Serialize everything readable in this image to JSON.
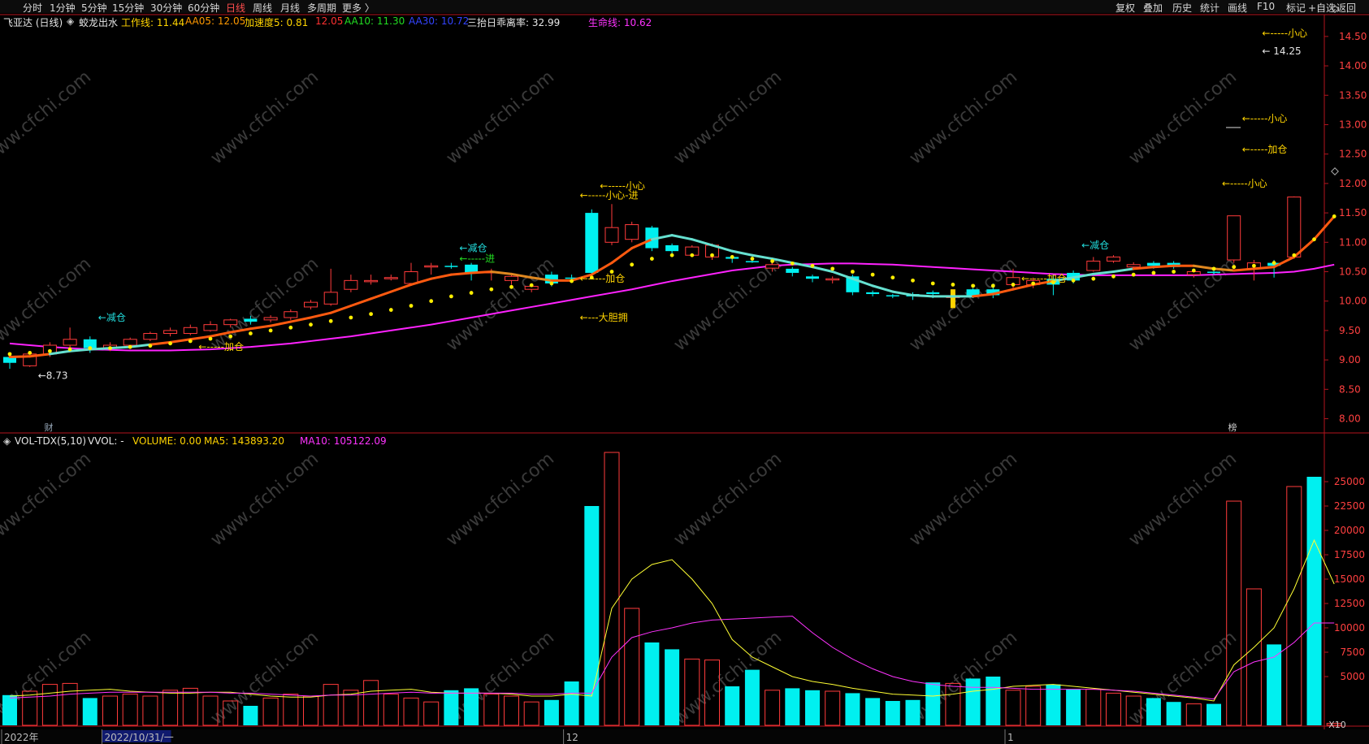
{
  "toolbar": {
    "left": [
      "分时",
      "1分钟",
      "5分钟",
      "15分钟",
      "30分钟",
      "60分钟",
      "日线",
      "周线",
      "月线",
      "多周期",
      "更多 〉"
    ],
    "active": "日线",
    "right": [
      "复权",
      "叠加",
      "历史",
      "统计",
      "画线",
      "F10",
      "标记",
      "+自选",
      "返回"
    ]
  },
  "header": {
    "stock": "飞亚达 (日线)",
    "indicator": "蛟龙出水",
    "items": [
      {
        "label": "工作线: 11.44",
        "color": "#ffd400"
      },
      {
        "label": "AA05: 12.05",
        "color": "#ff9900"
      },
      {
        "label": "加速度5: 0.81",
        "color": "#ffd400"
      },
      {
        "label": "12.05",
        "color": "#ff3030"
      },
      {
        "label": "AA10: 11.30",
        "color": "#22dd22"
      },
      {
        "label": "AA30: 10.72",
        "color": "#3344ff"
      },
      {
        "label": "三抬日乖离率: 32.99",
        "color": "#e6e6e6"
      },
      {
        "label": "生命线: 10.62",
        "color": "#ff33ff"
      }
    ]
  },
  "vol_header": {
    "name": "VOL-TDX(5,10)",
    "vvol": "VVOL: -",
    "volume": "VOLUME: 0.00",
    "ma5": "MA5: 143893.20",
    "ma10": "MA10: 105122.09"
  },
  "marks": {
    "cai": "财",
    "bang": "榜",
    "x10": "X10",
    "rixian": "日线"
  },
  "x_labels": [
    {
      "text": "2022年",
      "i": 0
    },
    {
      "text": "2022/10/31/一",
      "i": 5
    },
    {
      "text": "12",
      "i": 28
    },
    {
      "text": "1",
      "i": 50
    }
  ],
  "watermark": "www.cfchi.com",
  "annotations": [
    {
      "text": "←减仓",
      "i": 4,
      "price": 9.72,
      "color": "#22dddd"
    },
    {
      "text": "←-----加仓",
      "i": 9,
      "price": 9.22,
      "color": "#ffd400"
    },
    {
      "text": "←8.73",
      "i": 1,
      "price": 8.73,
      "color": "#e6e6e6"
    },
    {
      "text": "←减仓",
      "i": 22,
      "price": 10.9,
      "color": "#22dddd"
    },
    {
      "text": "←-----进",
      "i": 22,
      "price": 10.72,
      "color": "#22dd22"
    },
    {
      "text": "←-----小心",
      "i": 29,
      "price": 11.96,
      "color": "#ffd400"
    },
    {
      "text": "←-----小心-进",
      "i": 28,
      "price": 11.8,
      "color": "#ffd400"
    },
    {
      "text": "←-----加仓",
      "i": 28,
      "price": 10.38,
      "color": "#ffd400"
    },
    {
      "text": "←---大胆拥",
      "i": 28,
      "price": 9.72,
      "color": "#ffd400"
    },
    {
      "text": "←减仓",
      "i": 53,
      "price": 10.95,
      "color": "#22dddd"
    },
    {
      "text": "←-----加仓",
      "i": 50,
      "price": 10.38,
      "color": "#ffd400"
    },
    {
      "text": "←-----小心",
      "i": 60,
      "price": 12.0,
      "color": "#ffd400"
    },
    {
      "text": "←-----小心",
      "i": 61,
      "price": 13.1,
      "color": "#ffd400"
    },
    {
      "text": "←-----加仓",
      "i": 61,
      "price": 12.58,
      "color": "#ffd400"
    },
    {
      "text": "←-----小心",
      "i": 62,
      "price": 14.55,
      "color": "#ffd400"
    },
    {
      "text": "← 14.25",
      "i": 62,
      "price": 14.25,
      "color": "#e6e6e6"
    }
  ],
  "colors": {
    "up": "#ff3b3b",
    "down": "#00f0f0",
    "life": "#ff22ff",
    "dots": "#ffee00",
    "ma5": "#ffff33",
    "ma10": "#ff33ff",
    "axis": "#b4141e",
    "text": "#d0d0d0"
  },
  "chart_data": {
    "type": "candlestick",
    "price_axis": {
      "ticks": [
        8.0,
        8.5,
        9.0,
        9.5,
        10.0,
        10.5,
        11.0,
        11.5,
        12.0,
        12.5,
        13.0,
        13.5,
        14.0,
        14.5
      ],
      "range": [
        7.8,
        14.65
      ]
    },
    "volume_axis": {
      "ticks": [
        5000,
        7500,
        10000,
        12500,
        15000,
        17500,
        20000,
        22500,
        25000
      ],
      "range": [
        0,
        29000
      ]
    },
    "candles": [
      [
        9.05,
        8.95,
        9.1,
        8.85
      ],
      [
        8.9,
        9.1,
        9.12,
        8.88
      ],
      [
        9.1,
        9.25,
        9.3,
        9.05
      ],
      [
        9.25,
        9.35,
        9.55,
        9.2
      ],
      [
        9.35,
        9.2,
        9.4,
        9.12
      ],
      [
        9.2,
        9.25,
        9.3,
        9.15
      ],
      [
        9.25,
        9.35,
        9.38,
        9.22
      ],
      [
        9.35,
        9.45,
        9.48,
        9.32
      ],
      [
        9.45,
        9.5,
        9.55,
        9.4
      ],
      [
        9.45,
        9.55,
        9.6,
        9.42
      ],
      [
        9.5,
        9.6,
        9.66,
        9.48
      ],
      [
        9.6,
        9.68,
        9.7,
        9.55
      ],
      [
        9.65,
        9.7,
        9.75,
        9.6
      ],
      [
        9.68,
        9.72,
        9.76,
        9.64
      ],
      [
        9.72,
        9.82,
        9.86,
        9.68
      ],
      [
        9.9,
        9.98,
        10.02,
        9.86
      ],
      [
        9.95,
        10.15,
        10.55,
        9.92
      ],
      [
        10.2,
        10.35,
        10.45,
        10.15
      ],
      [
        10.35,
        10.35,
        10.45,
        10.28
      ],
      [
        10.4,
        10.4,
        10.45,
        10.35
      ],
      [
        10.3,
        10.5,
        10.65,
        10.28
      ],
      [
        10.6,
        10.6,
        10.65,
        10.45
      ],
      [
        10.6,
        10.6,
        10.65,
        10.55
      ],
      [
        10.62,
        10.48,
        10.65,
        10.35
      ],
      [
        10.5,
        10.5,
        10.55,
        10.35
      ],
      [
        10.42,
        10.35,
        10.45,
        10.28
      ],
      [
        10.25,
        10.2,
        10.3,
        10.15
      ],
      [
        10.3,
        10.45,
        10.5,
        10.25
      ],
      [
        10.4,
        10.4,
        10.45,
        10.35
      ],
      [
        10.48,
        11.5,
        11.56,
        10.45
      ],
      [
        11.0,
        11.25,
        11.65,
        10.95
      ],
      [
        11.3,
        11.05,
        11.35,
        11.0
      ],
      [
        11.25,
        10.9,
        11.28,
        10.85
      ],
      [
        10.95,
        10.85,
        10.98,
        10.75
      ],
      [
        10.78,
        10.92,
        10.95,
        10.75
      ],
      [
        10.95,
        10.75,
        10.98,
        10.7
      ],
      [
        10.75,
        10.72,
        10.78,
        10.65
      ],
      [
        10.68,
        10.68,
        10.72,
        10.65
      ],
      [
        10.62,
        10.56,
        10.68,
        10.5
      ],
      [
        10.55,
        10.48,
        10.58,
        10.42
      ],
      [
        10.42,
        10.38,
        10.45,
        10.32
      ],
      [
        10.38,
        10.38,
        10.42,
        10.3
      ],
      [
        10.42,
        10.15,
        10.45,
        10.1
      ],
      [
        10.15,
        10.12,
        10.18,
        10.08
      ],
      [
        10.1,
        10.08,
        10.12,
        10.05
      ],
      [
        10.12,
        10.08,
        10.15,
        10.02
      ],
      [
        10.15,
        10.12,
        10.18,
        10.05
      ],
      [
        10.08,
        10.08,
        10.2,
        9.9
      ],
      [
        10.2,
        10.1,
        10.22,
        10.05
      ],
      [
        10.1,
        10.2,
        10.3,
        10.05
      ],
      [
        10.28,
        10.4,
        10.55,
        10.2
      ],
      [
        10.35,
        10.28,
        10.4,
        10.22
      ],
      [
        10.28,
        10.38,
        10.45,
        10.1
      ],
      [
        10.35,
        10.48,
        10.52,
        10.3
      ],
      [
        10.52,
        10.68,
        10.75,
        10.5
      ],
      [
        10.75,
        10.68,
        10.78,
        10.65
      ],
      [
        10.62,
        10.58,
        10.66,
        10.55
      ],
      [
        10.6,
        10.65,
        10.68,
        10.55
      ],
      [
        10.65,
        10.58,
        10.68,
        10.55
      ],
      [
        10.5,
        10.45,
        10.55,
        10.4
      ],
      [
        10.48,
        10.5,
        10.55,
        10.45
      ],
      [
        11.45,
        10.7,
        11.45,
        10.65
      ],
      [
        10.65,
        10.55,
        10.7,
        10.35
      ],
      [
        10.6,
        10.65,
        10.7,
        10.4
      ],
      [
        10.75,
        11.77,
        11.78,
        10.72
      ]
    ],
    "cyan_indices": [
      0,
      4,
      12,
      22,
      23,
      27,
      28,
      29,
      32,
      33,
      36,
      37,
      39,
      40,
      42,
      43,
      44,
      45,
      46,
      48,
      49,
      52,
      53,
      57,
      58,
      60,
      63,
      65
    ],
    "work_line": [
      9.05,
      9.06,
      9.1,
      9.15,
      9.18,
      9.2,
      9.22,
      9.26,
      9.3,
      9.35,
      9.4,
      9.47,
      9.53,
      9.58,
      9.65,
      9.72,
      9.8,
      9.92,
      10.04,
      10.16,
      10.28,
      10.38,
      10.45,
      10.48,
      10.5,
      10.46,
      10.4,
      10.35,
      10.35,
      10.45,
      10.65,
      10.9,
      11.05,
      11.12,
      11.05,
      10.95,
      10.85,
      10.78,
      10.72,
      10.65,
      10.58,
      10.5,
      10.38,
      10.26,
      10.16,
      10.1,
      10.08,
      10.08,
      10.08,
      10.12,
      10.2,
      10.28,
      10.34,
      10.4,
      10.46,
      10.5,
      10.55,
      10.58,
      10.6,
      10.6,
      10.55,
      10.52,
      10.55,
      10.58,
      10.75,
      11.05,
      11.44
    ],
    "work_line_cyan_ranges": [
      [
        2,
        7
      ],
      [
        32,
        48
      ],
      [
        52,
        56
      ]
    ],
    "life_line": [
      9.28,
      9.25,
      9.22,
      9.2,
      9.18,
      9.17,
      9.16,
      9.16,
      9.16,
      9.17,
      9.18,
      9.2,
      9.22,
      9.25,
      9.28,
      9.32,
      9.36,
      9.4,
      9.45,
      9.5,
      9.55,
      9.6,
      9.66,
      9.72,
      9.78,
      9.84,
      9.9,
      9.96,
      10.02,
      10.08,
      10.14,
      10.2,
      10.27,
      10.34,
      10.4,
      10.46,
      10.52,
      10.56,
      10.6,
      10.62,
      10.63,
      10.64,
      10.64,
      10.63,
      10.62,
      10.6,
      10.58,
      10.56,
      10.54,
      10.52,
      10.5,
      10.48,
      10.46,
      10.45,
      10.44,
      10.44,
      10.44,
      10.44,
      10.44,
      10.44,
      10.45,
      10.46,
      10.47,
      10.48,
      10.5,
      10.55,
      10.62
    ],
    "dots": [
      9.1,
      9.12,
      9.15,
      9.18,
      9.2,
      9.2,
      9.22,
      9.24,
      9.28,
      9.32,
      9.36,
      9.4,
      9.45,
      9.5,
      9.55,
      9.6,
      9.66,
      9.72,
      9.78,
      9.85,
      9.92,
      10.0,
      10.08,
      10.14,
      10.2,
      10.24,
      10.27,
      10.3,
      10.34,
      10.4,
      10.5,
      10.62,
      10.72,
      10.78,
      10.78,
      10.78,
      10.75,
      10.72,
      10.68,
      10.64,
      10.6,
      10.55,
      10.5,
      10.45,
      10.4,
      10.35,
      10.3,
      10.28,
      10.26,
      10.26,
      10.28,
      10.3,
      10.32,
      10.35,
      10.38,
      10.42,
      10.45,
      10.48,
      10.5,
      10.52,
      10.55,
      10.58,
      10.6,
      10.65,
      10.78,
      11.05,
      11.44
    ],
    "volume": [
      3100,
      3500,
      4200,
      4300,
      2800,
      3000,
      3200,
      3000,
      3600,
      3800,
      3000,
      2500,
      2000,
      2800,
      3200,
      3000,
      4200,
      3600,
      4600,
      3200,
      2800,
      2400,
      3600,
      3800,
      3200,
      3000,
      2400,
      2600,
      4500,
      22500,
      28000,
      12000,
      8500,
      7800,
      6800,
      6700,
      4000,
      5700,
      3600,
      3800,
      3600,
      3500,
      3300,
      2800,
      2500,
      2600,
      4400,
      4300,
      4800,
      5000,
      3600,
      4000,
      4200,
      3700,
      3700,
      3300,
      3000,
      2800,
      2400,
      2200,
      2200,
      23000,
      14000,
      8300,
      24500,
      25500,
      200
    ],
    "ma5": [
      3000,
      3100,
      3300,
      3500,
      3600,
      3700,
      3500,
      3400,
      3300,
      3300,
      3400,
      3400,
      3200,
      3000,
      2900,
      2900,
      3100,
      3200,
      3500,
      3600,
      3700,
      3400,
      3300,
      3300,
      3300,
      3200,
      3000,
      3000,
      3200,
      3000,
      12000,
      15000,
      16500,
      17000,
      15000,
      12500,
      8800,
      7000,
      6000,
      5000,
      4500,
      4200,
      3800,
      3500,
      3200,
      3100,
      3000,
      3200,
      3500,
      3700,
      4000,
      4100,
      4200,
      4000,
      3800,
      3600,
      3400,
      3200,
      3000,
      2800,
      2500,
      6200,
      8000,
      10000,
      14000,
      19000,
      14500
    ],
    "ma10": [
      2800,
      2900,
      3000,
      3200,
      3300,
      3400,
      3400,
      3400,
      3400,
      3400,
      3400,
      3300,
      3300,
      3200,
      3100,
      3000,
      3100,
      3100,
      3200,
      3300,
      3400,
      3300,
      3300,
      3300,
      3300,
      3300,
      3200,
      3200,
      3300,
      3300,
      7000,
      9000,
      9600,
      10000,
      10500,
      10800,
      10900,
      11000,
      11100,
      11200,
      9500,
      8000,
      6800,
      5800,
      5000,
      4500,
      4200,
      4000,
      3900,
      3900,
      3800,
      3700,
      3700,
      3700,
      3700,
      3600,
      3500,
      3300,
      3100,
      2900,
      2700,
      5500,
      6500,
      7000,
      8500,
      10500,
      10500
    ]
  }
}
